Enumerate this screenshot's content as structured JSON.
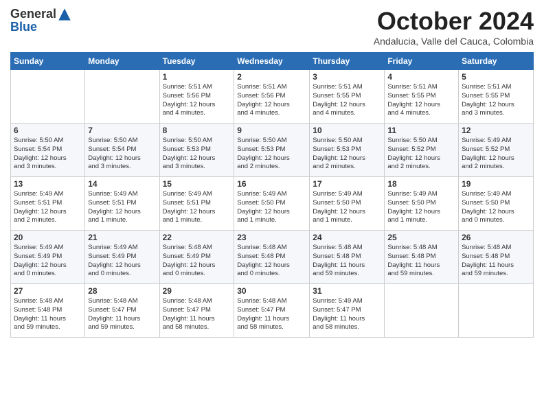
{
  "logo": {
    "general": "General",
    "blue": "Blue"
  },
  "title": "October 2024",
  "subtitle": "Andalucia, Valle del Cauca, Colombia",
  "days_header": [
    "Sunday",
    "Monday",
    "Tuesday",
    "Wednesday",
    "Thursday",
    "Friday",
    "Saturday"
  ],
  "weeks": [
    [
      {
        "day": "",
        "info": ""
      },
      {
        "day": "",
        "info": ""
      },
      {
        "day": "1",
        "info": "Sunrise: 5:51 AM\nSunset: 5:56 PM\nDaylight: 12 hours\nand 4 minutes."
      },
      {
        "day": "2",
        "info": "Sunrise: 5:51 AM\nSunset: 5:56 PM\nDaylight: 12 hours\nand 4 minutes."
      },
      {
        "day": "3",
        "info": "Sunrise: 5:51 AM\nSunset: 5:55 PM\nDaylight: 12 hours\nand 4 minutes."
      },
      {
        "day": "4",
        "info": "Sunrise: 5:51 AM\nSunset: 5:55 PM\nDaylight: 12 hours\nand 4 minutes."
      },
      {
        "day": "5",
        "info": "Sunrise: 5:51 AM\nSunset: 5:55 PM\nDaylight: 12 hours\nand 3 minutes."
      }
    ],
    [
      {
        "day": "6",
        "info": "Sunrise: 5:50 AM\nSunset: 5:54 PM\nDaylight: 12 hours\nand 3 minutes."
      },
      {
        "day": "7",
        "info": "Sunrise: 5:50 AM\nSunset: 5:54 PM\nDaylight: 12 hours\nand 3 minutes."
      },
      {
        "day": "8",
        "info": "Sunrise: 5:50 AM\nSunset: 5:53 PM\nDaylight: 12 hours\nand 3 minutes."
      },
      {
        "day": "9",
        "info": "Sunrise: 5:50 AM\nSunset: 5:53 PM\nDaylight: 12 hours\nand 2 minutes."
      },
      {
        "day": "10",
        "info": "Sunrise: 5:50 AM\nSunset: 5:53 PM\nDaylight: 12 hours\nand 2 minutes."
      },
      {
        "day": "11",
        "info": "Sunrise: 5:50 AM\nSunset: 5:52 PM\nDaylight: 12 hours\nand 2 minutes."
      },
      {
        "day": "12",
        "info": "Sunrise: 5:49 AM\nSunset: 5:52 PM\nDaylight: 12 hours\nand 2 minutes."
      }
    ],
    [
      {
        "day": "13",
        "info": "Sunrise: 5:49 AM\nSunset: 5:51 PM\nDaylight: 12 hours\nand 2 minutes."
      },
      {
        "day": "14",
        "info": "Sunrise: 5:49 AM\nSunset: 5:51 PM\nDaylight: 12 hours\nand 1 minute."
      },
      {
        "day": "15",
        "info": "Sunrise: 5:49 AM\nSunset: 5:51 PM\nDaylight: 12 hours\nand 1 minute."
      },
      {
        "day": "16",
        "info": "Sunrise: 5:49 AM\nSunset: 5:50 PM\nDaylight: 12 hours\nand 1 minute."
      },
      {
        "day": "17",
        "info": "Sunrise: 5:49 AM\nSunset: 5:50 PM\nDaylight: 12 hours\nand 1 minute."
      },
      {
        "day": "18",
        "info": "Sunrise: 5:49 AM\nSunset: 5:50 PM\nDaylight: 12 hours\nand 1 minute."
      },
      {
        "day": "19",
        "info": "Sunrise: 5:49 AM\nSunset: 5:50 PM\nDaylight: 12 hours\nand 0 minutes."
      }
    ],
    [
      {
        "day": "20",
        "info": "Sunrise: 5:49 AM\nSunset: 5:49 PM\nDaylight: 12 hours\nand 0 minutes."
      },
      {
        "day": "21",
        "info": "Sunrise: 5:49 AM\nSunset: 5:49 PM\nDaylight: 12 hours\nand 0 minutes."
      },
      {
        "day": "22",
        "info": "Sunrise: 5:48 AM\nSunset: 5:49 PM\nDaylight: 12 hours\nand 0 minutes."
      },
      {
        "day": "23",
        "info": "Sunrise: 5:48 AM\nSunset: 5:48 PM\nDaylight: 12 hours\nand 0 minutes."
      },
      {
        "day": "24",
        "info": "Sunrise: 5:48 AM\nSunset: 5:48 PM\nDaylight: 11 hours\nand 59 minutes."
      },
      {
        "day": "25",
        "info": "Sunrise: 5:48 AM\nSunset: 5:48 PM\nDaylight: 11 hours\nand 59 minutes."
      },
      {
        "day": "26",
        "info": "Sunrise: 5:48 AM\nSunset: 5:48 PM\nDaylight: 11 hours\nand 59 minutes."
      }
    ],
    [
      {
        "day": "27",
        "info": "Sunrise: 5:48 AM\nSunset: 5:48 PM\nDaylight: 11 hours\nand 59 minutes."
      },
      {
        "day": "28",
        "info": "Sunrise: 5:48 AM\nSunset: 5:47 PM\nDaylight: 11 hours\nand 59 minutes."
      },
      {
        "day": "29",
        "info": "Sunrise: 5:48 AM\nSunset: 5:47 PM\nDaylight: 11 hours\nand 58 minutes."
      },
      {
        "day": "30",
        "info": "Sunrise: 5:48 AM\nSunset: 5:47 PM\nDaylight: 11 hours\nand 58 minutes."
      },
      {
        "day": "31",
        "info": "Sunrise: 5:49 AM\nSunset: 5:47 PM\nDaylight: 11 hours\nand 58 minutes."
      },
      {
        "day": "",
        "info": ""
      },
      {
        "day": "",
        "info": ""
      }
    ]
  ]
}
